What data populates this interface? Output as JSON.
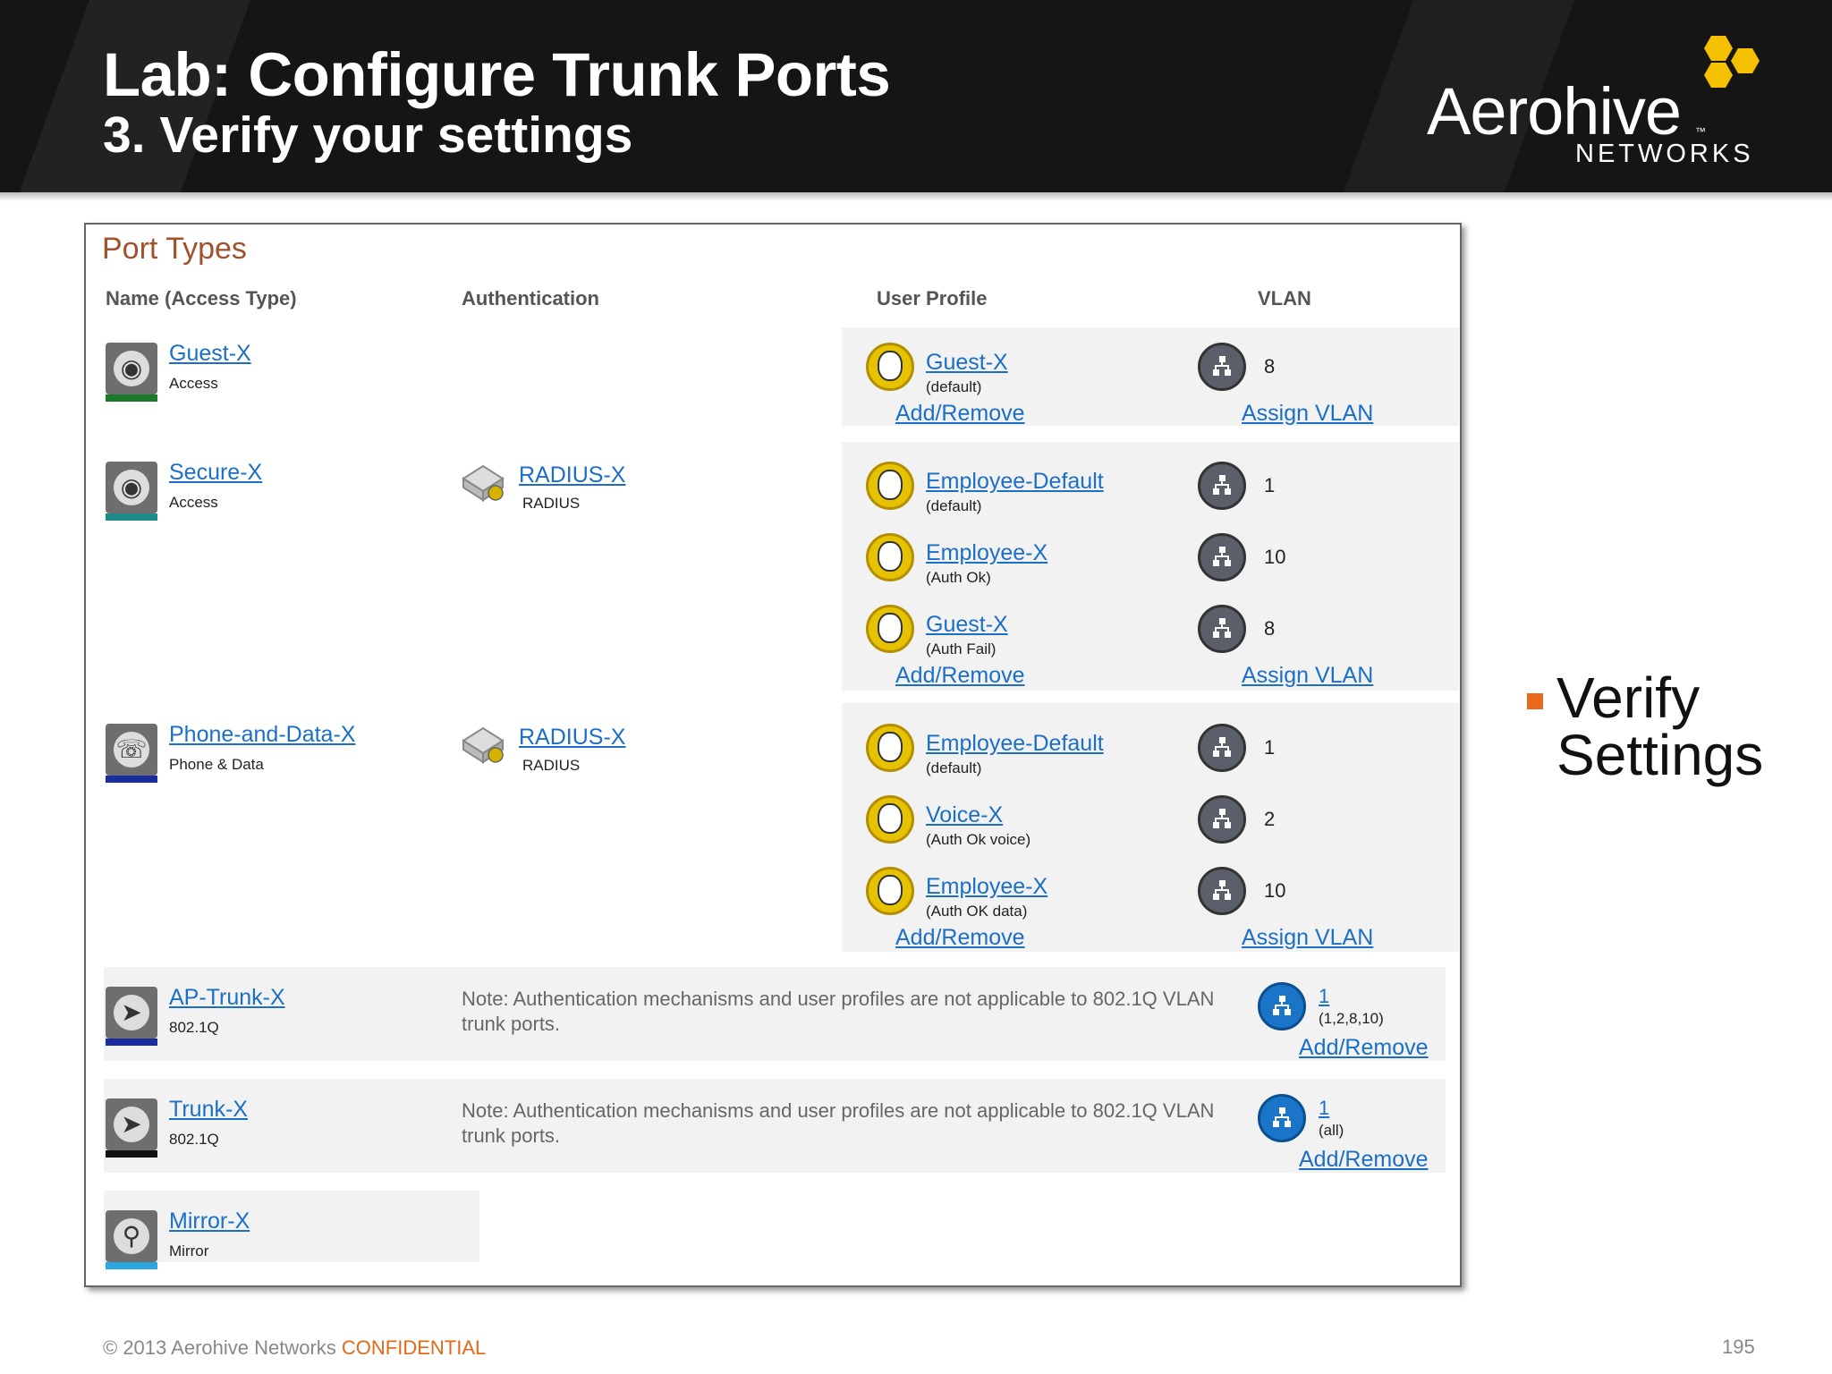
{
  "header": {
    "title": "Lab: Configure Trunk Ports",
    "subtitle": "3. Verify your settings",
    "logo_word": "Aerohive",
    "logo_tm": "™",
    "logo_sub": "NETWORKS"
  },
  "panel": {
    "title": "Port Types",
    "columns": {
      "name": "Name (Access Type)",
      "auth": "Authentication",
      "user_profile": "User Profile",
      "vlan": "VLAN"
    },
    "add_remove": "Add/Remove",
    "assign_vlan": "Assign VLAN",
    "ports": [
      {
        "name": "Guest-X",
        "type": "Access",
        "auth": null,
        "profiles": [
          {
            "name": "Guest-X",
            "note": "(default)",
            "vlan": "8"
          }
        ]
      },
      {
        "name": "Secure-X",
        "type": "Access",
        "auth": {
          "name": "RADIUS-X",
          "type": "RADIUS"
        },
        "profiles": [
          {
            "name": "Employee-Default",
            "note": "(default)",
            "vlan": "1"
          },
          {
            "name": "Employee-X",
            "note": "(Auth Ok)",
            "vlan": "10"
          },
          {
            "name": "Guest-X",
            "note": "(Auth Fail)",
            "vlan": "8"
          }
        ]
      },
      {
        "name": "Phone-and-Data-X",
        "type": "Phone & Data",
        "auth": {
          "name": "RADIUS-X",
          "type": "RADIUS"
        },
        "profiles": [
          {
            "name": "Employee-Default",
            "note": "(default)",
            "vlan": "1"
          },
          {
            "name": "Voice-X",
            "note": "(Auth Ok voice)",
            "vlan": "2"
          },
          {
            "name": "Employee-X",
            "note": "(Auth OK data)",
            "vlan": "10"
          }
        ]
      },
      {
        "name": "AP-Trunk-X",
        "type": "802.1Q",
        "note": "Note: Authentication mechanisms and user profiles are not applicable to 802.1Q VLAN trunk ports.",
        "vlan": "1",
        "vlan_list": "(1,2,8,10)"
      },
      {
        "name": "Trunk-X",
        "type": "802.1Q",
        "note": "Note: Authentication mechanisms and user profiles are not applicable to 802.1Q VLAN trunk ports.",
        "vlan": "1",
        "vlan_list": "(all)"
      },
      {
        "name": "Mirror-X",
        "type": "Mirror"
      }
    ]
  },
  "bullet": "Verify Settings",
  "footer": {
    "copyright": "© 2013 Aerohive Networks",
    "confidential": "CONFIDENTIAL",
    "page": "195"
  },
  "colors": {
    "accent_orange": "#e96b1c",
    "link_blue": "#1b6fc7",
    "logo_yellow": "#f5c000",
    "bar_green": "#1a7a2a",
    "bar_teal": "#1f8c8c",
    "bar_navy": "#1a2da0",
    "bar_black": "#111111",
    "bar_cyan": "#2aa7e0"
  }
}
